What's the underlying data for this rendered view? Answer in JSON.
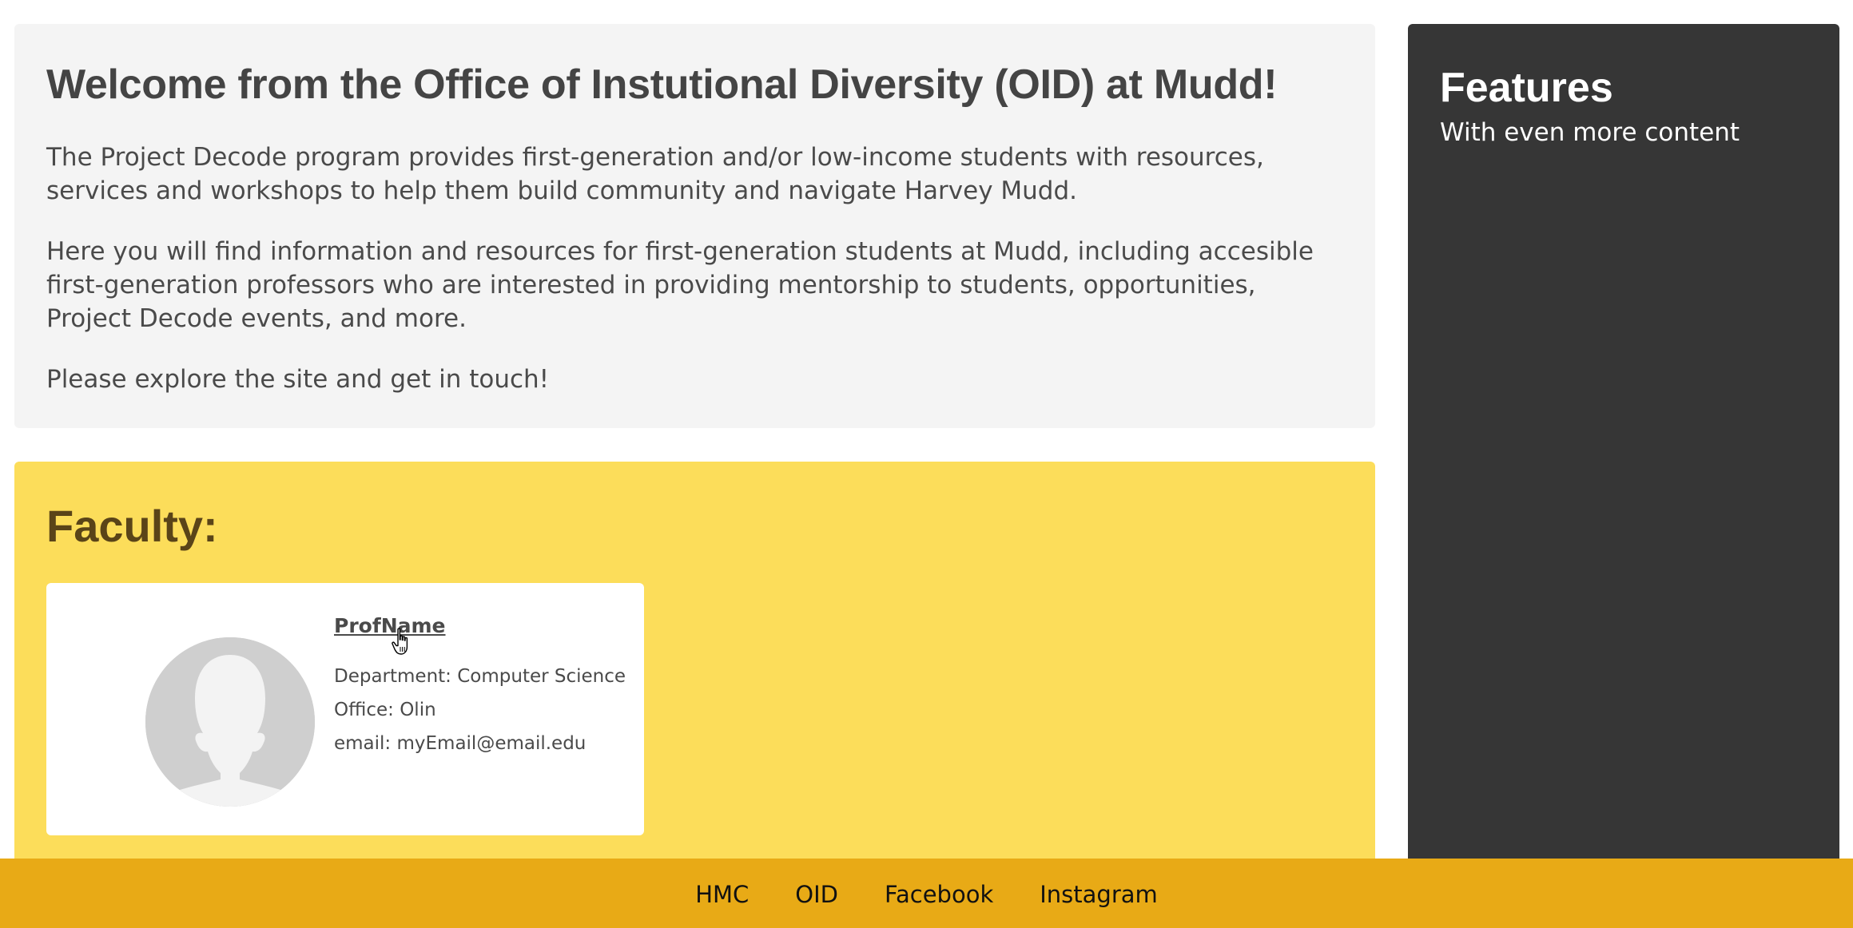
{
  "welcome": {
    "title": "Welcome from the Office of Instutional Diversity (OID) at Mudd!",
    "paragraph_1": "The Project Decode program provides first-generation and/or low-income students with resources, services and workshops to help them build community and navigate Harvey Mudd.",
    "paragraph_2": "Here you will find information and resources for first-generation students at Mudd, including accesible first-generation professors who are interested in providing mentorship to students, opportunities, Project Decode events, and more.",
    "paragraph_3": "Please explore the site and get in touch!"
  },
  "sidebar": {
    "title": "Features",
    "subtitle": "With even more content"
  },
  "faculty": {
    "heading": "Faculty:",
    "card": {
      "name": "ProfName",
      "department": "Department: Computer Science",
      "office": "Office: Olin",
      "email": "email: myEmail@email.edu"
    }
  },
  "footer": {
    "links": [
      "HMC",
      "OID",
      "Facebook",
      "Instagram"
    ]
  },
  "colors": {
    "welcome_bg": "#f4f4f4",
    "sidebar_bg": "#363636",
    "faculty_bg": "#fcdd5a",
    "footer_bg": "#e8aa16"
  },
  "icons": {
    "avatar": "default-user-avatar-icon",
    "cursor": "hand-pointer-cursor-icon"
  }
}
